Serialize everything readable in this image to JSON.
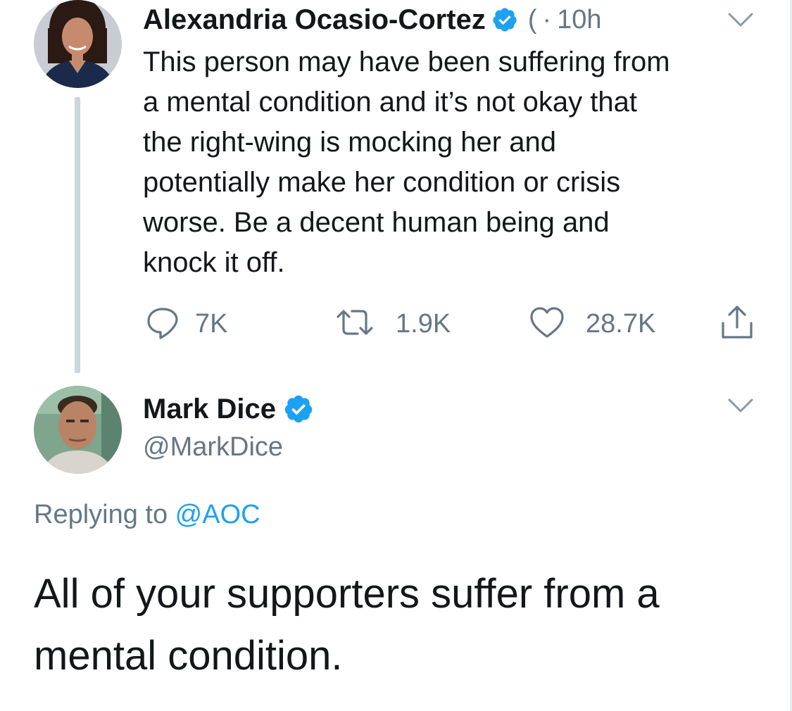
{
  "parent_tweet": {
    "author_name": "Alexandria Ocasio-Cortez",
    "handle_fragment": "(",
    "separator": "·",
    "time": "10h",
    "text": "This person may have been suffering from\na mental condition and it’s not okay that\nthe right-wing is mocking her and\npotentially make her condition or crisis\nworse. Be a decent human being and\nknock it off.",
    "actions": {
      "reply_count": "7K",
      "retweet_count": "1.9K",
      "like_count": "28.7K"
    },
    "icons": {
      "verified": "verified-badge-icon",
      "menu": "chevron-down-icon",
      "reply": "reply-bubble-icon",
      "retweet": "retweet-icon",
      "like": "heart-icon",
      "share": "share-icon"
    }
  },
  "reply_tweet": {
    "author_name": "Mark Dice",
    "handle": "@MarkDice",
    "replying_prefix": "Replying to ",
    "replying_mention": "@AOC",
    "text": "All of your supporters suffer from a mental condition."
  },
  "colors": {
    "accent_blue": "#1da1f2",
    "secondary_text": "#657786",
    "primary_text": "#14171a",
    "thread_line": "#ccd6dd"
  }
}
